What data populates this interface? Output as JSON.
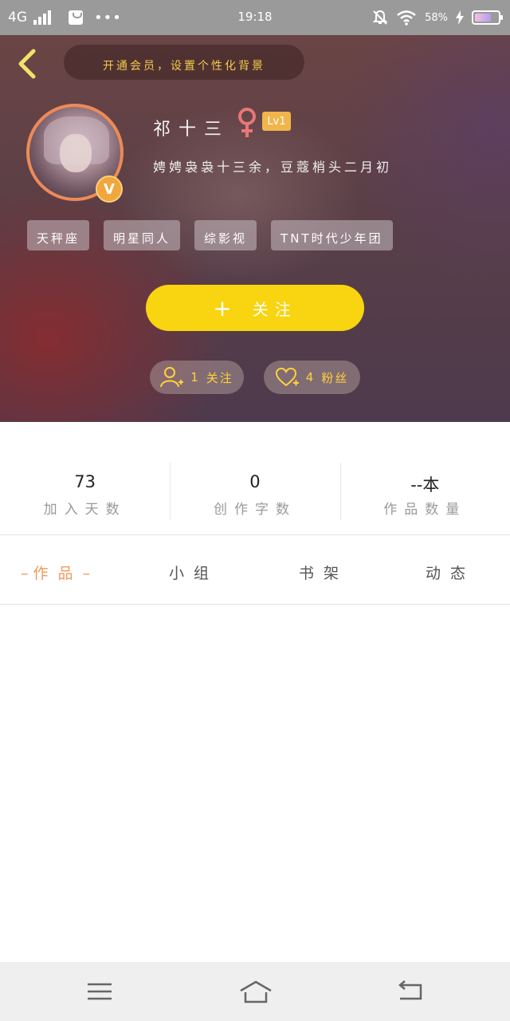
{
  "status_bar": {
    "network": "4G",
    "time": "19:18",
    "battery": "58%",
    "icons": [
      "signal-icon",
      "shopping-bag-icon",
      "more-dots-icon",
      "mute-bell-icon",
      "wifi-icon",
      "charging-icon",
      "battery-icon"
    ]
  },
  "header": {
    "vip_banner": "开通会员，设置个性化背景",
    "username": "祁十三",
    "gender": "female",
    "level": "Lv1",
    "bio": "娉娉袅袅十三余，豆蔻梢头二月初",
    "vip_badge": "V",
    "tags": [
      "天秤座",
      "明星同人",
      "综影视",
      "TNT时代少年团"
    ],
    "follow_button": "关注",
    "following_count": "1",
    "following_label": "关注",
    "fans_count": "4",
    "fans_label": "粉丝"
  },
  "stats": [
    {
      "value": "73",
      "label": "加入天数"
    },
    {
      "value": "0",
      "label": "创作字数"
    },
    {
      "value": "--本",
      "label": "作品数量"
    }
  ],
  "tabs": {
    "works": "作品",
    "groups": "小组",
    "shelf": "书架",
    "feed": "动态",
    "active": "works"
  },
  "colors": {
    "accent_yellow": "#f8d411",
    "active_tab": "#ee9a5e",
    "level_badge": "#f2b54b",
    "gender_icon": "#e97777"
  }
}
